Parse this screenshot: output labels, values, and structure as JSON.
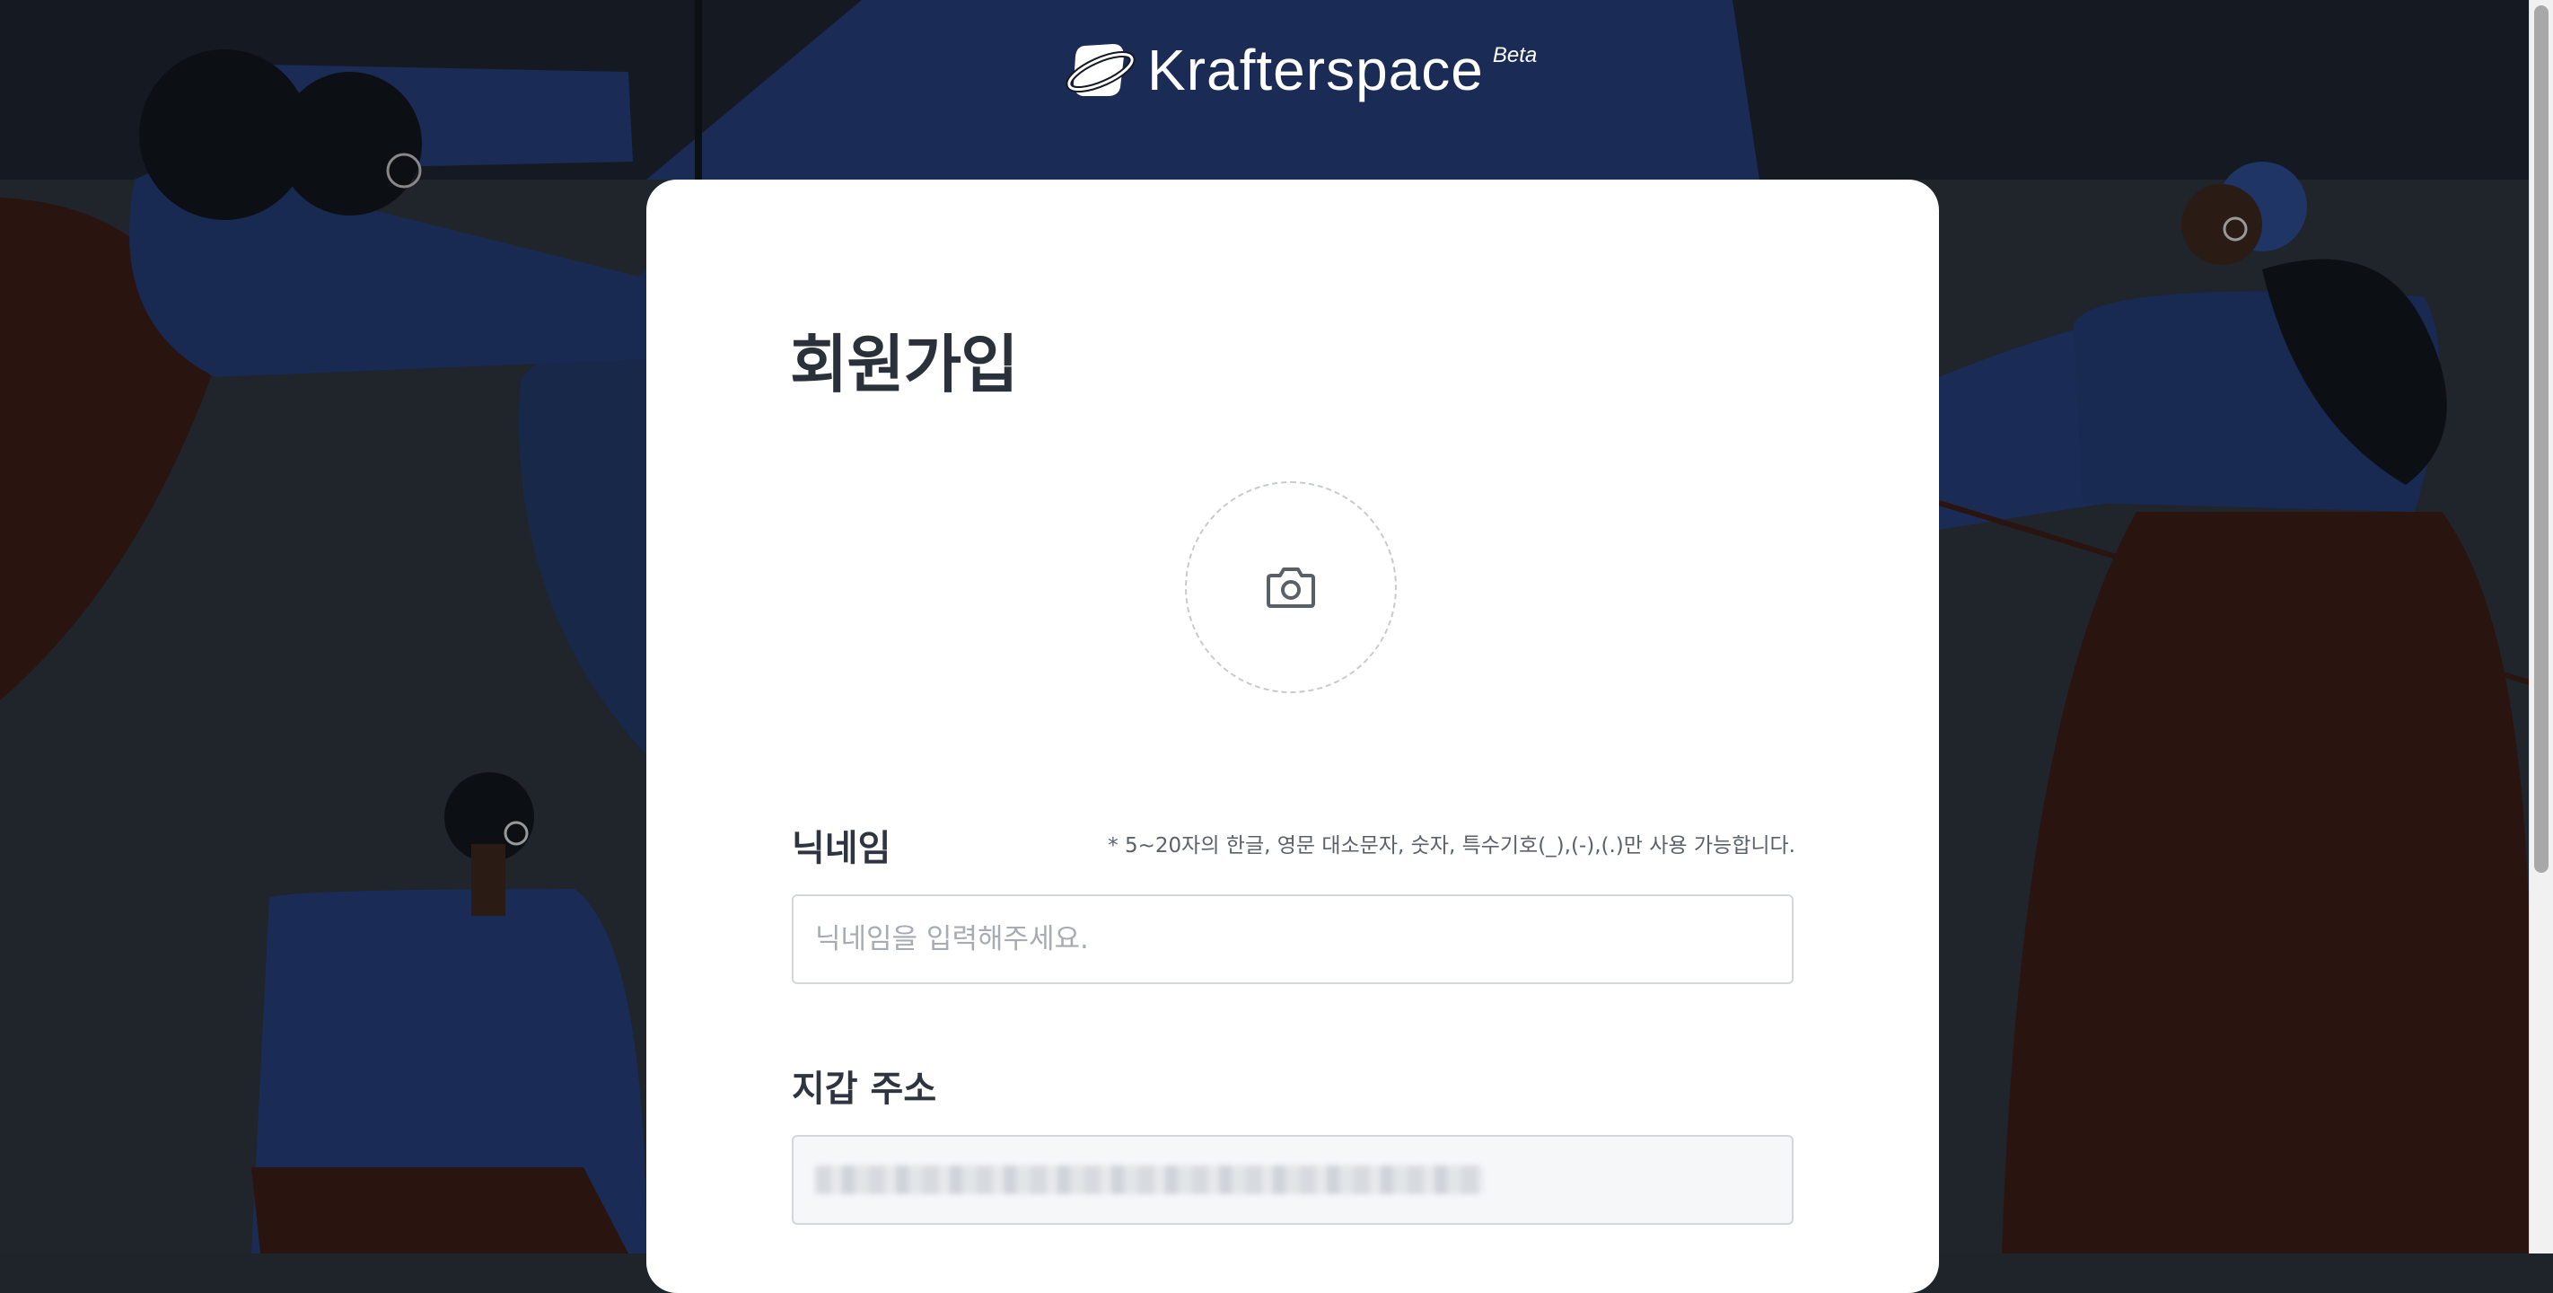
{
  "brand": {
    "name": "Krafterspace",
    "badge": "Beta"
  },
  "signup": {
    "title": "회원가입",
    "avatar": {
      "icon": "camera-icon"
    },
    "nickname": {
      "label": "닉네임",
      "hint": "* 5~20자의 한글, 영문 대소문자, 숫자, 특수기호(_),(-),(.)만 사용 가능합니다.",
      "placeholder": "닉네임을 입력해주세요.",
      "value": ""
    },
    "wallet": {
      "label": "지갑 주소",
      "value_redacted": true
    }
  },
  "colors": {
    "background": "#1f232a",
    "illustration_blue": "#1a2d57",
    "illustration_brown": "#2a1410",
    "card": "#ffffff",
    "title_text": "#2b313a",
    "input_border": "#d3d7dc"
  }
}
